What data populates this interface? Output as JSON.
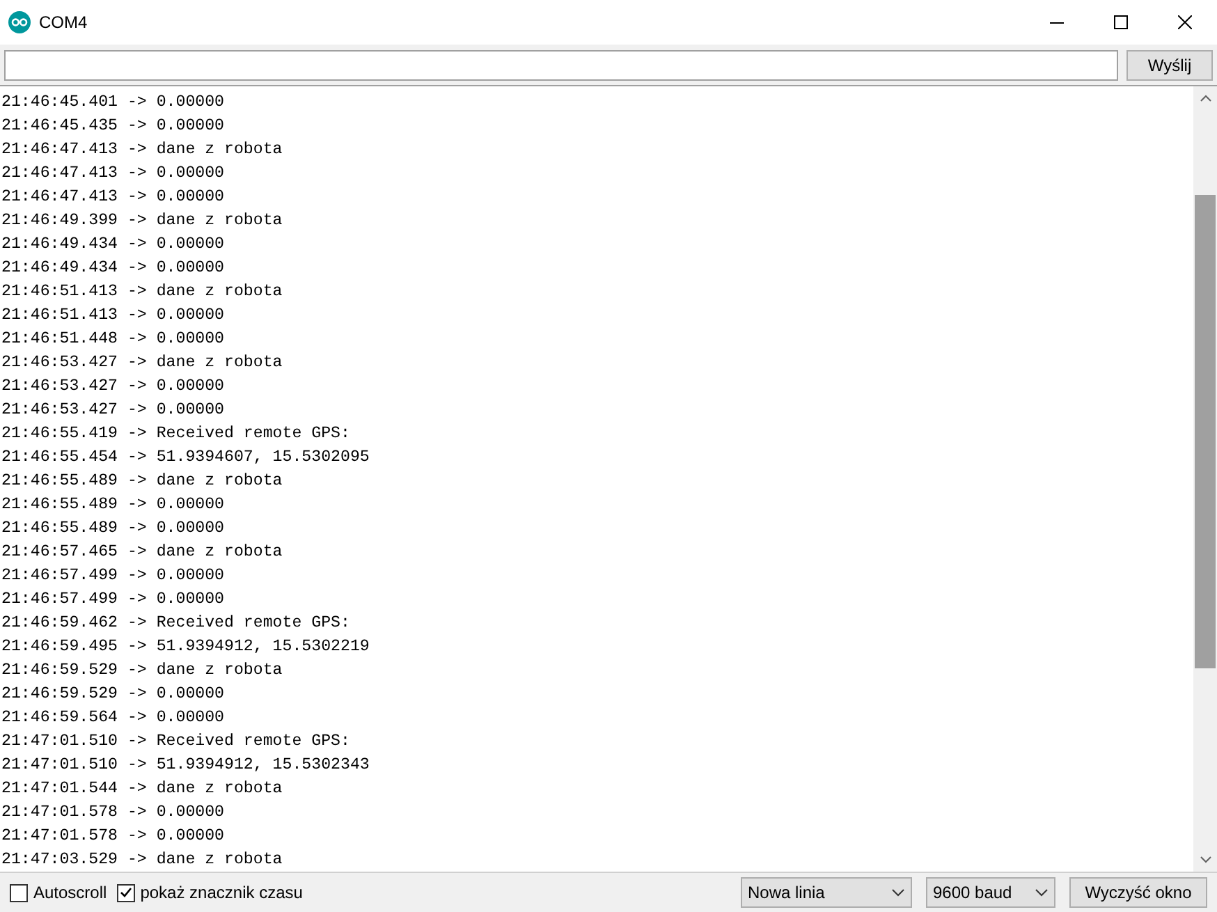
{
  "window": {
    "title": "COM4"
  },
  "send_button": "Wyślij",
  "log": [
    "21:46:45.401 -> 0.00000",
    "21:46:45.435 -> 0.00000",
    "21:46:47.413 -> dane z robota",
    "21:46:47.413 -> 0.00000",
    "21:46:47.413 -> 0.00000",
    "21:46:49.399 -> dane z robota",
    "21:46:49.434 -> 0.00000",
    "21:46:49.434 -> 0.00000",
    "21:46:51.413 -> dane z robota",
    "21:46:51.413 -> 0.00000",
    "21:46:51.448 -> 0.00000",
    "21:46:53.427 -> dane z robota",
    "21:46:53.427 -> 0.00000",
    "21:46:53.427 -> 0.00000",
    "21:46:55.419 -> Received remote GPS:",
    "21:46:55.454 -> 51.9394607, 15.5302095",
    "21:46:55.489 -> dane z robota",
    "21:46:55.489 -> 0.00000",
    "21:46:55.489 -> 0.00000",
    "21:46:57.465 -> dane z robota",
    "21:46:57.499 -> 0.00000",
    "21:46:57.499 -> 0.00000",
    "21:46:59.462 -> Received remote GPS:",
    "21:46:59.495 -> 51.9394912, 15.5302219",
    "21:46:59.529 -> dane z robota",
    "21:46:59.529 -> 0.00000",
    "21:46:59.564 -> 0.00000",
    "21:47:01.510 -> Received remote GPS:",
    "21:47:01.510 -> 51.9394912, 15.5302343",
    "21:47:01.544 -> dane z robota",
    "21:47:01.578 -> 0.00000",
    "21:47:01.578 -> 0.00000",
    "21:47:03.529 -> dane z robota"
  ],
  "footer": {
    "checkboxes": [
      {
        "label": "Autoscroll",
        "checked": false
      },
      {
        "label": "pokaż znacznik czasu",
        "checked": true
      }
    ],
    "line_ending": "Nowa linia",
    "baud": "9600 baud",
    "clear_button": "Wyczyść okno"
  }
}
